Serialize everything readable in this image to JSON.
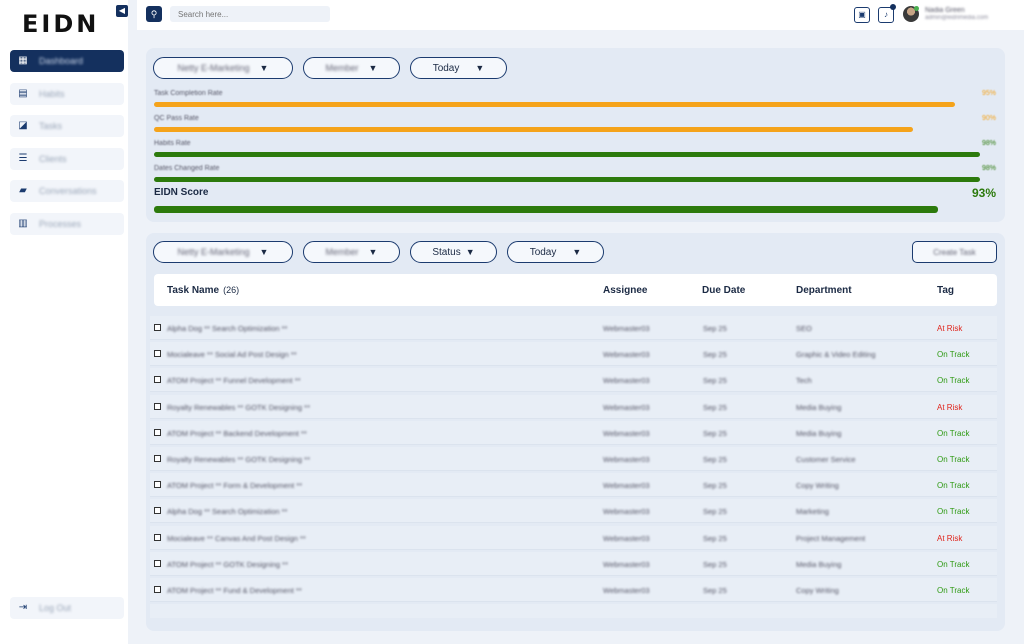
{
  "app": {
    "logo": "EIDN",
    "collapse_icon": "collapse-arrow-icon"
  },
  "sidebar": {
    "items": [
      {
        "label": "Dashboard",
        "icon": "dashboard-icon",
        "active": true
      },
      {
        "label": "Habits",
        "icon": "inbox-icon",
        "active": false
      },
      {
        "label": "Tasks",
        "icon": "chart-icon",
        "active": false
      },
      {
        "label": "Clients",
        "icon": "list-icon",
        "active": false
      },
      {
        "label": "Conversations",
        "icon": "chat-icon",
        "active": false
      },
      {
        "label": "Processes",
        "icon": "clipboard-icon",
        "active": false
      }
    ],
    "logout_label": "Log Out"
  },
  "topbar": {
    "search_placeholder": "Search here...",
    "user_name": "Nadia Green",
    "user_email": "admin@eidnmedia.com"
  },
  "overview": {
    "filters": {
      "company": "Netty E-Marketing",
      "member": "Member",
      "date": "Today"
    },
    "metrics": [
      {
        "label": "Task Completion Rate",
        "pct_text": "95%",
        "value": 0.95,
        "color": "#f5a31a"
      },
      {
        "label": "QC Pass Rate",
        "pct_text": "90%",
        "value": 0.9,
        "color": "#f5a31a"
      },
      {
        "label": "Habits Rate",
        "pct_text": "98%",
        "value": 0.98,
        "color": "#2c7a0c"
      },
      {
        "label": "Dates Changed Rate",
        "pct_text": "98%",
        "value": 0.98,
        "color": "#2c7a0c"
      }
    ],
    "score_label": "EIDN Score",
    "score_text": "93%",
    "score_value": 0.93
  },
  "tasks": {
    "filters": {
      "company": "Netty E-Marketing",
      "member": "Member",
      "status": "Status",
      "date": "Today"
    },
    "create_label": "Create Task",
    "columns": {
      "name": "Task Name",
      "count": "(26)",
      "assignee": "Assignee",
      "due": "Due Date",
      "department": "Department",
      "tag": "Tag"
    },
    "rows": [
      {
        "name": "Alpha Dog ** Search Optimization **",
        "assignee": "Webmaster03",
        "due": "Sep 25",
        "department": "SEO",
        "tag": "At Risk"
      },
      {
        "name": "Mocialeave ** Social Ad Post Design **",
        "assignee": "Webmaster03",
        "due": "Sep 25",
        "department": "Graphic & Video Editing",
        "tag": "On Track"
      },
      {
        "name": "ATOM Project ** Funnel Development **",
        "assignee": "Webmaster03",
        "due": "Sep 25",
        "department": "Tech",
        "tag": "On Track"
      },
      {
        "name": "Royalty Renewables ** GOTK Designing **",
        "assignee": "Webmaster03",
        "due": "Sep 25",
        "department": "Media Buying",
        "tag": "At Risk"
      },
      {
        "name": "ATOM Project ** Backend Development **",
        "assignee": "Webmaster03",
        "due": "Sep 25",
        "department": "Media Buying",
        "tag": "On Track"
      },
      {
        "name": "Royalty Renewables ** GOTK Designing **",
        "assignee": "Webmaster03",
        "due": "Sep 25",
        "department": "Customer Service",
        "tag": "On Track"
      },
      {
        "name": "ATOM Project ** Form & Development **",
        "assignee": "Webmaster03",
        "due": "Sep 25",
        "department": "Copy Writing",
        "tag": "On Track"
      },
      {
        "name": "Alpha Dog ** Search Optimization **",
        "assignee": "Webmaster03",
        "due": "Sep 25",
        "department": "Marketing",
        "tag": "On Track"
      },
      {
        "name": "Mocialeave ** Canvas And Post Design **",
        "assignee": "Webmaster03",
        "due": "Sep 25",
        "department": "Project Management",
        "tag": "At Risk"
      },
      {
        "name": "ATOM Project ** GOTK Designing **",
        "assignee": "Webmaster03",
        "due": "Sep 25",
        "department": "Media Buying",
        "tag": "On Track"
      },
      {
        "name": "ATOM Project ** Fund & Development **",
        "assignee": "Webmaster03",
        "due": "Sep 25",
        "department": "Copy Writing",
        "tag": "On Track"
      }
    ]
  }
}
